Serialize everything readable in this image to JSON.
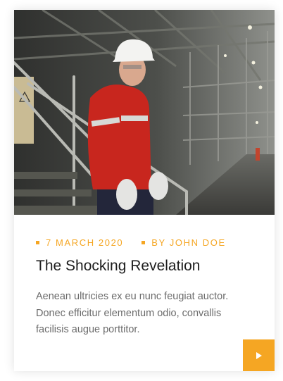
{
  "post": {
    "date": "7 MARCH 2020",
    "author": "BY JOHN DOE",
    "title": "The Shocking Revelation",
    "excerpt": "Aenean ultricies ex eu nunc feugiat auctor. Donec efficitur elementum odio, convallis facilisis augue porttitor."
  },
  "photo": {
    "subject": "worker in red jacket and white hard hat on industrial plant stairway"
  },
  "icons": {
    "meta_bullet": "square-bullet-icon",
    "read_more": "play-arrow-icon"
  },
  "colors": {
    "accent": "#f5a623",
    "title": "#1d1d1d",
    "text": "#6b6b6b"
  }
}
